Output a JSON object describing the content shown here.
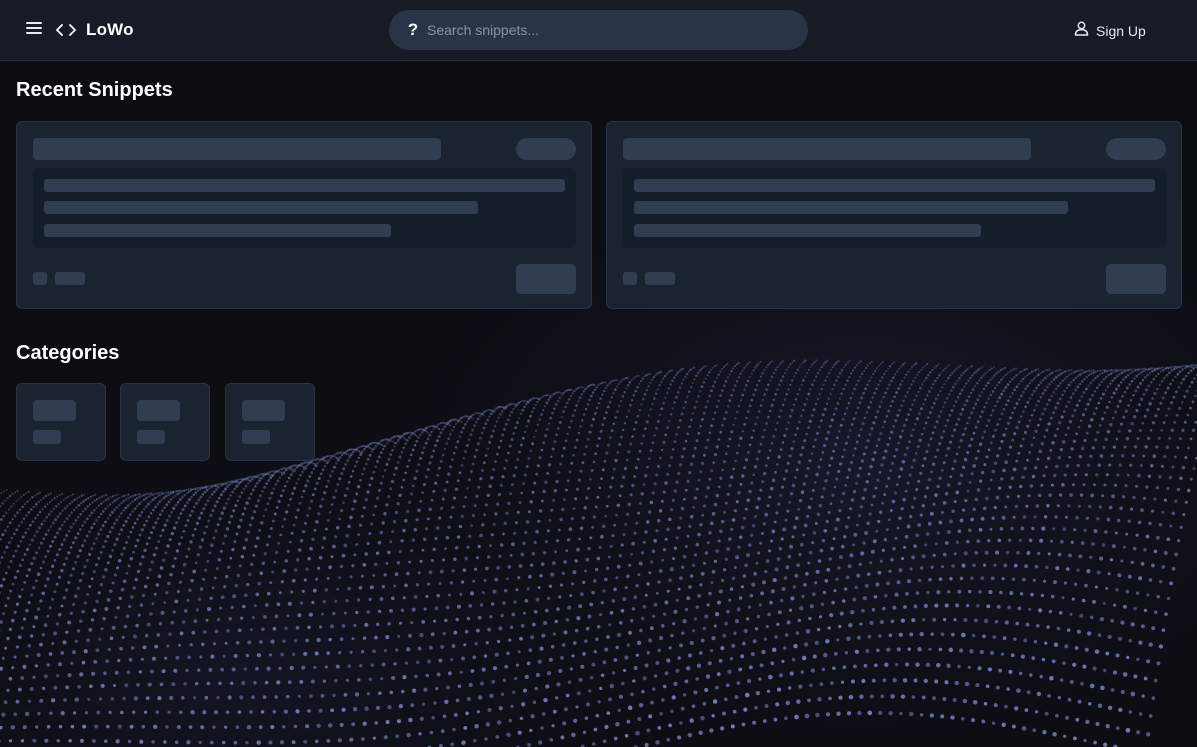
{
  "header": {
    "menu_icon": "hamburger-menu-icon",
    "brand_icon": "code-brackets-icon",
    "brand_name": "LoWo",
    "search": {
      "icon": "question-mark-icon",
      "icon_glyph": "?",
      "placeholder": "Search snippets...",
      "value": ""
    },
    "signup": {
      "icon": "user-icon",
      "label": "Sign Up"
    }
  },
  "recent_snippets": {
    "title": "Recent Snippets",
    "state": "loading-skeleton"
  },
  "categories": {
    "title": "Categories",
    "state": "loading-skeleton"
  },
  "colors": {
    "background": "#0c0d12",
    "topbar": "#161b26",
    "search_bg": "#2b3446",
    "card_bg": "#1b2331",
    "skeleton": "#323d50",
    "wave_dots": "#7f8bc4"
  }
}
